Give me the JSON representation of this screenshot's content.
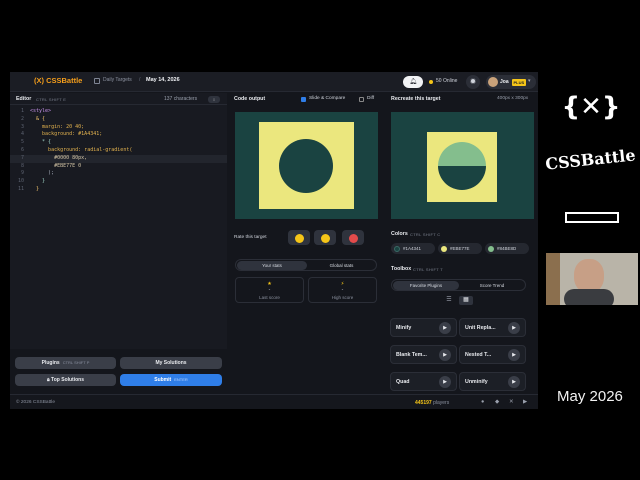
{
  "topbar": {
    "logo": "(X) CSSBattle",
    "breadcrumb": "Daily Targets",
    "breadcrumb_sep": "/",
    "date": "May 14, 2026",
    "online": "50 Online",
    "user": "Joa",
    "plus_badge": "PLUS"
  },
  "editor": {
    "title": "Editor",
    "shortcut": "CTRL  SHIFT  E",
    "char_count": "137 characters",
    "toggle": "↕",
    "lines": [
      {
        "n": "1",
        "code": "<style>"
      },
      {
        "n": "2",
        "code": "  & {"
      },
      {
        "n": "3",
        "code": "    margin: 20 40;"
      },
      {
        "n": "4",
        "code": "    background: #1A4341;"
      },
      {
        "n": "5",
        "code": "    * {"
      },
      {
        "n": "6",
        "code": "      background: radial-gradient("
      },
      {
        "n": "7",
        "code": "        #0000 80px,"
      },
      {
        "n": "8",
        "code": "        #EBE77E 0"
      },
      {
        "n": "9",
        "code": "      );"
      },
      {
        "n": "10",
        "code": "    }"
      },
      {
        "n": "11",
        "code": "  }"
      }
    ],
    "plugins_btn": "Plugins",
    "plugins_kbd": "CTRL  SHIFT  P",
    "solutions_btn": "My Solutions",
    "top_btn": "Top Solutions",
    "submit_btn": "Submit",
    "submit_kbd": "ENTER"
  },
  "output": {
    "title": "Code output",
    "slide_label": "Slide & Compare",
    "diff_label": "Diff",
    "rate_label": "Rate this target",
    "your_stats": "Your stats",
    "global_stats": "Global stats",
    "last_score_val": "-",
    "last_score": "Last score",
    "high_score_val": "-",
    "high_score": "High score"
  },
  "target": {
    "title": "Recreate this target",
    "size": "400px x 300px",
    "colors_title": "Colors",
    "colors_kbd": "CTRL  SHIFT  C",
    "colors": [
      {
        "hex": "#1A4341",
        "label": "#1A4341"
      },
      {
        "hex": "#EBE77E",
        "label": "#EBE77E"
      },
      {
        "hex": "#84BE8D",
        "label": "#84BE8D"
      }
    ],
    "toolbox_title": "Toolbox",
    "toolbox_kbd": "CTRL  SHIFT  T",
    "fav_tab": "Favorite Plugins",
    "score_tab": "Score Trend",
    "plugins": [
      "Minify",
      "Unit Repla...",
      "Blank Tem...",
      "Nested T...",
      "Quad",
      "Unminify"
    ]
  },
  "footer": {
    "copyright": "© 2026 CSSBattle",
    "players_count": "445197",
    "players_label": "players"
  },
  "side": {
    "date": "May 2026"
  }
}
